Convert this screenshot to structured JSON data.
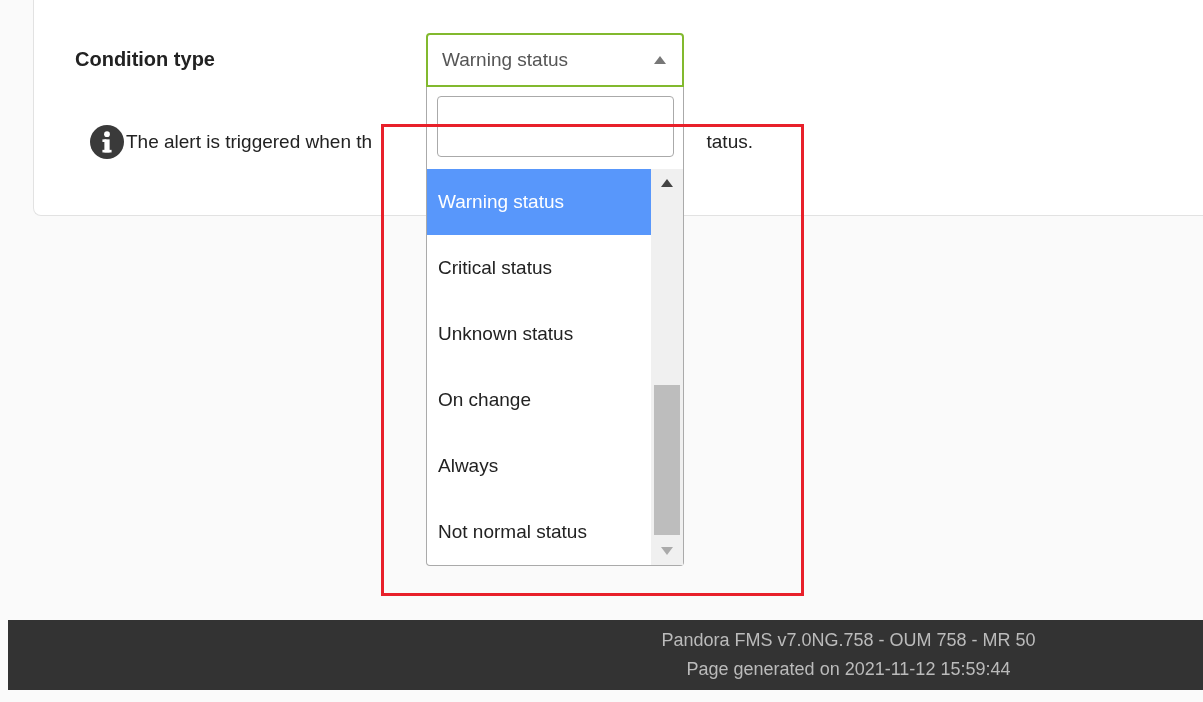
{
  "condition": {
    "label": "Condition type",
    "select": {
      "value": "Warning status",
      "expanded": true
    },
    "help": [
      "The alert is triggered when th",
      "tatus."
    ]
  },
  "options": [
    {
      "label": "Warning status",
      "selected": true
    },
    {
      "label": "Critical status",
      "selected": false
    },
    {
      "label": "Unknown status",
      "selected": false
    },
    {
      "label": "On change",
      "selected": false
    },
    {
      "label": "Always",
      "selected": false
    },
    {
      "label": "Not normal status",
      "selected": false
    }
  ],
  "footer": [
    "Pandora FMS v7.0NG.758 - OUM 758 - MR 50",
    "Page generated on 2021-11-12 15:59:44"
  ]
}
